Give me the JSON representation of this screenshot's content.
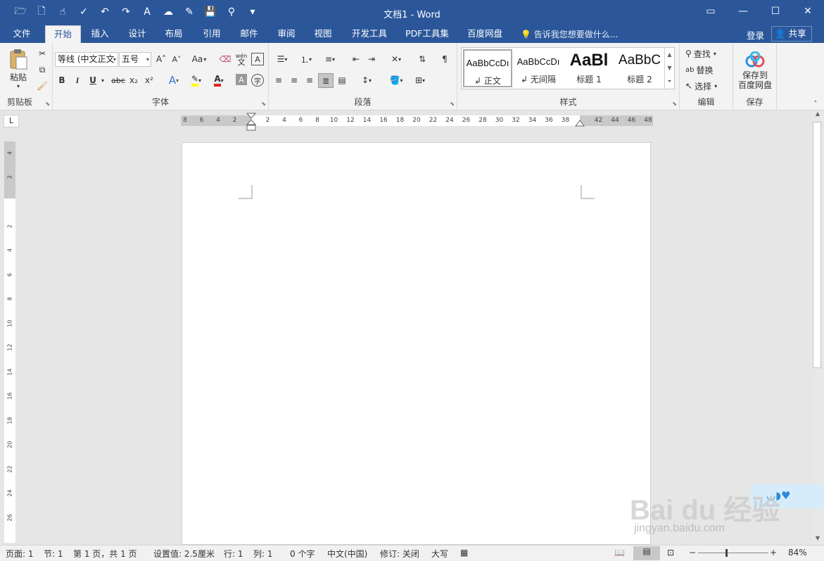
{
  "window": {
    "title": "文档1 - Word",
    "accent_color": "#2b579a"
  },
  "quick_access": [
    {
      "icon": "open-folder-icon",
      "glyph": "🗁"
    },
    {
      "icon": "new-document-icon",
      "glyph": "🗋"
    },
    {
      "icon": "touch-mode-icon",
      "glyph": "☝"
    },
    {
      "icon": "spelling-check-icon",
      "glyph": "✓"
    },
    {
      "icon": "undo-icon",
      "glyph": "↶"
    },
    {
      "icon": "redo-icon",
      "glyph": "↷"
    },
    {
      "icon": "font-icon",
      "glyph": "A"
    },
    {
      "icon": "baidu-upload-icon",
      "glyph": "☁"
    },
    {
      "icon": "edit-icon",
      "glyph": "✎"
    },
    {
      "icon": "save-icon",
      "glyph": "💾"
    },
    {
      "icon": "search-icon",
      "glyph": "⚲"
    },
    {
      "icon": "customize-qat-icon",
      "glyph": "▾"
    }
  ],
  "window_controls": {
    "ribbon_display": "▭",
    "minimize": "—",
    "maximize": "☐",
    "close": "✕"
  },
  "tabs": [
    {
      "label": "文件",
      "active": false
    },
    {
      "label": "开始",
      "active": true
    },
    {
      "label": "插入",
      "active": false
    },
    {
      "label": "设计",
      "active": false
    },
    {
      "label": "布局",
      "active": false
    },
    {
      "label": "引用",
      "active": false
    },
    {
      "label": "邮件",
      "active": false
    },
    {
      "label": "审阅",
      "active": false
    },
    {
      "label": "视图",
      "active": false
    },
    {
      "label": "开发工具",
      "active": false
    },
    {
      "label": "PDF工具集",
      "active": false
    },
    {
      "label": "百度网盘",
      "active": false
    }
  ],
  "tell_me": "告诉我您想要做什么...",
  "account": {
    "login": "登录",
    "share": "共享"
  },
  "ribbon": {
    "clipboard": {
      "label": "剪贴板",
      "paste": "粘贴"
    },
    "font": {
      "label": "字体",
      "font_name": "等线 (中文正文",
      "font_size": "五号",
      "bold": "B",
      "italic": "I",
      "underline": "U",
      "strike": "abc",
      "subscript": "x₂",
      "superscript": "x²",
      "grow": "A˄",
      "shrink": "A˅",
      "case": "Aa",
      "phonetic_top": "wén",
      "phonetic_bottom": "文"
    },
    "paragraph": {
      "label": "段落"
    },
    "styles": {
      "label": "样式",
      "items": [
        {
          "sample": "AaBbCcDı",
          "name": "正文",
          "selected": true,
          "size": 13
        },
        {
          "sample": "AaBbCcDı",
          "name": "无间隔",
          "selected": false,
          "size": 13
        },
        {
          "sample": "AaBl",
          "name": "标题 1",
          "selected": false,
          "size": 24
        },
        {
          "sample": "AaBbC",
          "name": "标题 2",
          "selected": false,
          "size": 19
        }
      ]
    },
    "editing": {
      "label": "编辑",
      "find": "查找",
      "replace": "替换",
      "select": "选择"
    },
    "save": {
      "label": "保存",
      "button_line1": "保存到",
      "button_line2": "百度网盘"
    }
  },
  "ruler": {
    "horizontal_left": [
      "8",
      "6",
      "4",
      "2"
    ],
    "horizontal_right": [
      "2",
      "4",
      "6",
      "8",
      "10",
      "12",
      "14",
      "16",
      "18",
      "20",
      "22",
      "24",
      "26",
      "28",
      "30",
      "32",
      "34",
      "36",
      "38"
    ],
    "horizontal_far": [
      "42",
      "44",
      "46",
      "48"
    ],
    "vertical": [
      "4",
      "2",
      "2",
      "4",
      "6",
      "8",
      "10",
      "12",
      "14",
      "16",
      "18",
      "20",
      "22",
      "24",
      "26"
    ],
    "corner": "L"
  },
  "status": {
    "page": "页面: 1",
    "section": "节: 1",
    "page_of": "第 1 页，共 1 页",
    "setting": "设置值: 2.5厘米",
    "line": "行: 1",
    "column": "列: 1",
    "words": "0 个字",
    "language": "中文(中国)",
    "track": "修订: 关闭",
    "caps": "大写",
    "zoom": "84%",
    "zoom_level": 84
  },
  "watermark": {
    "main": "Bai du 经验",
    "sub": "jingyan.baidu.com"
  }
}
